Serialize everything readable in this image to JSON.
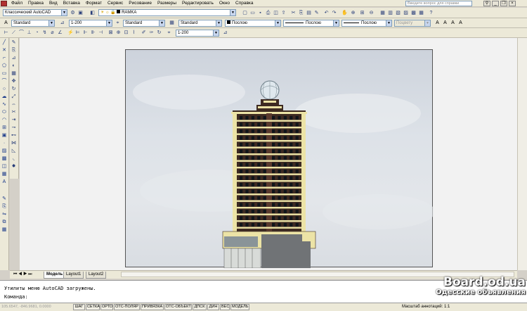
{
  "menu": [
    "Файл",
    "Правка",
    "Вид",
    "Вставка",
    "Формат",
    "Сервис",
    "Рисование",
    "Размеры",
    "Редактировать",
    "Окно",
    "Справка"
  ],
  "help_search_placeholder": "Введите вопрос для справки",
  "toolbar1": {
    "workspace": "Классический AutoCAD",
    "layer": "RAMKA"
  },
  "toolbar2": {
    "text_style": "Standard",
    "dim_scale": "1-200",
    "dim_style": "Standard",
    "table_style": "Standard",
    "color": "Послою",
    "linetype": "Послою",
    "lineweight": "Послою",
    "plotstyle": "Поцвету"
  },
  "toolbar3": {
    "scale": "1-200"
  },
  "tabs": [
    "Модель",
    "Layout1",
    "Layout2"
  ],
  "command": {
    "history": "Утилиты меню AutoCAD загружены.",
    "prompt": "Команда:"
  },
  "status": {
    "coords": "105.6547, -846.9681, 0.0000",
    "buttons": [
      "ШАГ",
      "СЕТКА",
      "ОРТО",
      "ОТС-ПОЛЯР",
      "ПРИВЯЗКА",
      "ОТС-ОБЪЕКТ",
      "ДПСК",
      "ДИН",
      "ВЕС",
      "МОДЕЛЬ"
    ],
    "annotation_scale_label": "Масштаб аннотаций:",
    "annotation_scale_value": "1:1"
  },
  "watermark": {
    "line1": "Board.od.ua",
    "line2": "Одесские объявления"
  },
  "colors": {
    "facade": "#3d2a22",
    "balcony": "#ece3a6",
    "base": "#707376",
    "sky": "#d6dbe2"
  }
}
